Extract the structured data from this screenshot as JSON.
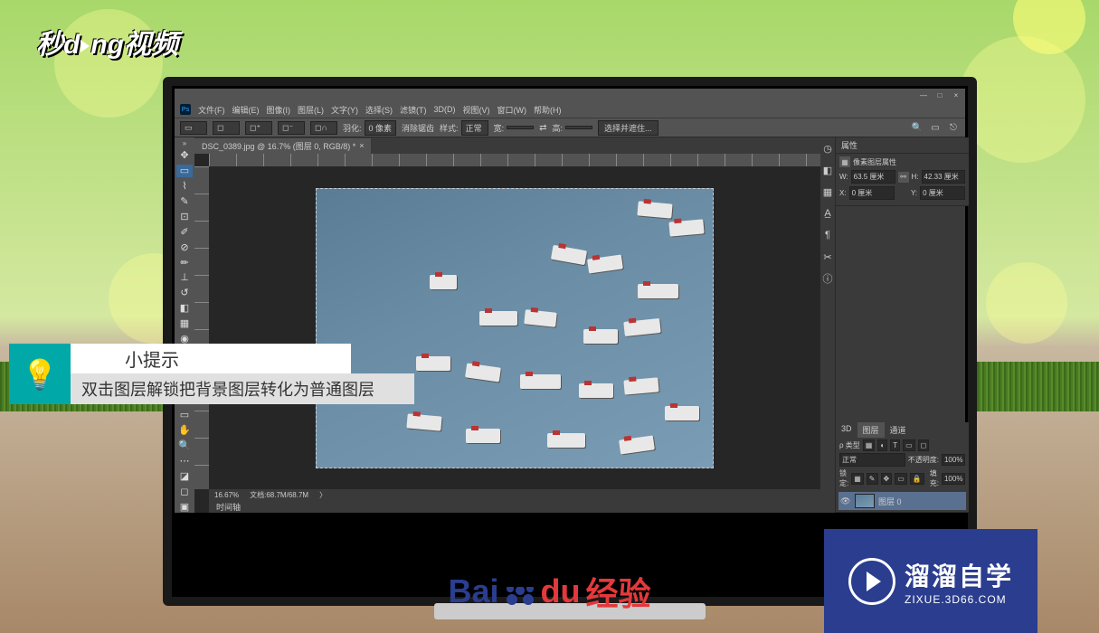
{
  "logo_top_left": "秒dòng视频",
  "titlebar": {
    "min": "—",
    "max": "□",
    "close": "×"
  },
  "menu": [
    "文件(F)",
    "编辑(E)",
    "图像(I)",
    "图层(L)",
    "文字(Y)",
    "选择(S)",
    "滤镜(T)",
    "3D(D)",
    "视图(V)",
    "窗口(W)",
    "帮助(H)"
  ],
  "options": {
    "feather_label": "羽化:",
    "feather_value": "0 像素",
    "antialias": "消除锯齿",
    "style_label": "样式:",
    "style_value": "正常",
    "w_label": "宽:",
    "h_label": "高:",
    "refine": "选择并遮住..."
  },
  "doc": {
    "tab": "DSC_0389.jpg @ 16.7% (图层 0, RGB/8) *",
    "zoom": "16.67%",
    "docinfo": "文档:68.7M/68.7M",
    "timeline": "时间轴"
  },
  "props": {
    "title": "属性",
    "subtitle": "像素图层属性",
    "w_label": "W:",
    "w_value": "63.5 厘米",
    "h_label": "H:",
    "h_value": "42.33 厘米",
    "x_label": "X:",
    "x_value": "0 厘米",
    "y_label": "Y:",
    "y_value": "0 厘米"
  },
  "layers": {
    "tabs": [
      "3D",
      "图层",
      "通道"
    ],
    "kind_label": "ρ 类型",
    "blend": "正常",
    "opacity_label": "不透明度:",
    "opacity_value": "100%",
    "lock_label": "锁定:",
    "fill_label": "填充:",
    "fill_value": "100%",
    "layer0": "图层 0"
  },
  "tip": {
    "title": "小提示",
    "text": "双击图层解锁把背景图层转化为普通图层"
  },
  "baidu": {
    "bai": "Bai",
    "du": "du",
    "jy": "经验"
  },
  "zixue": {
    "t1": "溜溜自学",
    "t2": "ZIXUE.3D66.COM"
  }
}
